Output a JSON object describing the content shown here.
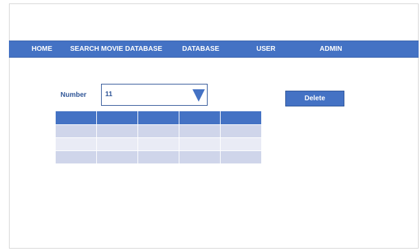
{
  "nav": {
    "items": [
      {
        "label": "HOME"
      },
      {
        "label": "SEARCH MOVIE DATABASE"
      },
      {
        "label": "DATABASE"
      },
      {
        "label": "USER"
      },
      {
        "label": "ADMIN"
      }
    ]
  },
  "form": {
    "number_label": "Number",
    "number_value": "11",
    "dropdown_icon": "triangle-down-icon"
  },
  "actions": {
    "delete_label": "Delete"
  },
  "table": {
    "columns": [
      "",
      "",
      "",
      "",
      ""
    ],
    "rows": [
      [
        "",
        "",
        "",
        "",
        ""
      ],
      [
        "",
        "",
        "",
        "",
        ""
      ],
      [
        "",
        "",
        "",
        "",
        ""
      ]
    ]
  },
  "colors": {
    "accent": "#4472c4",
    "accent_dark": "#2f5597",
    "row_dark": "#cfd5ea",
    "row_light": "#e9ebf5"
  }
}
